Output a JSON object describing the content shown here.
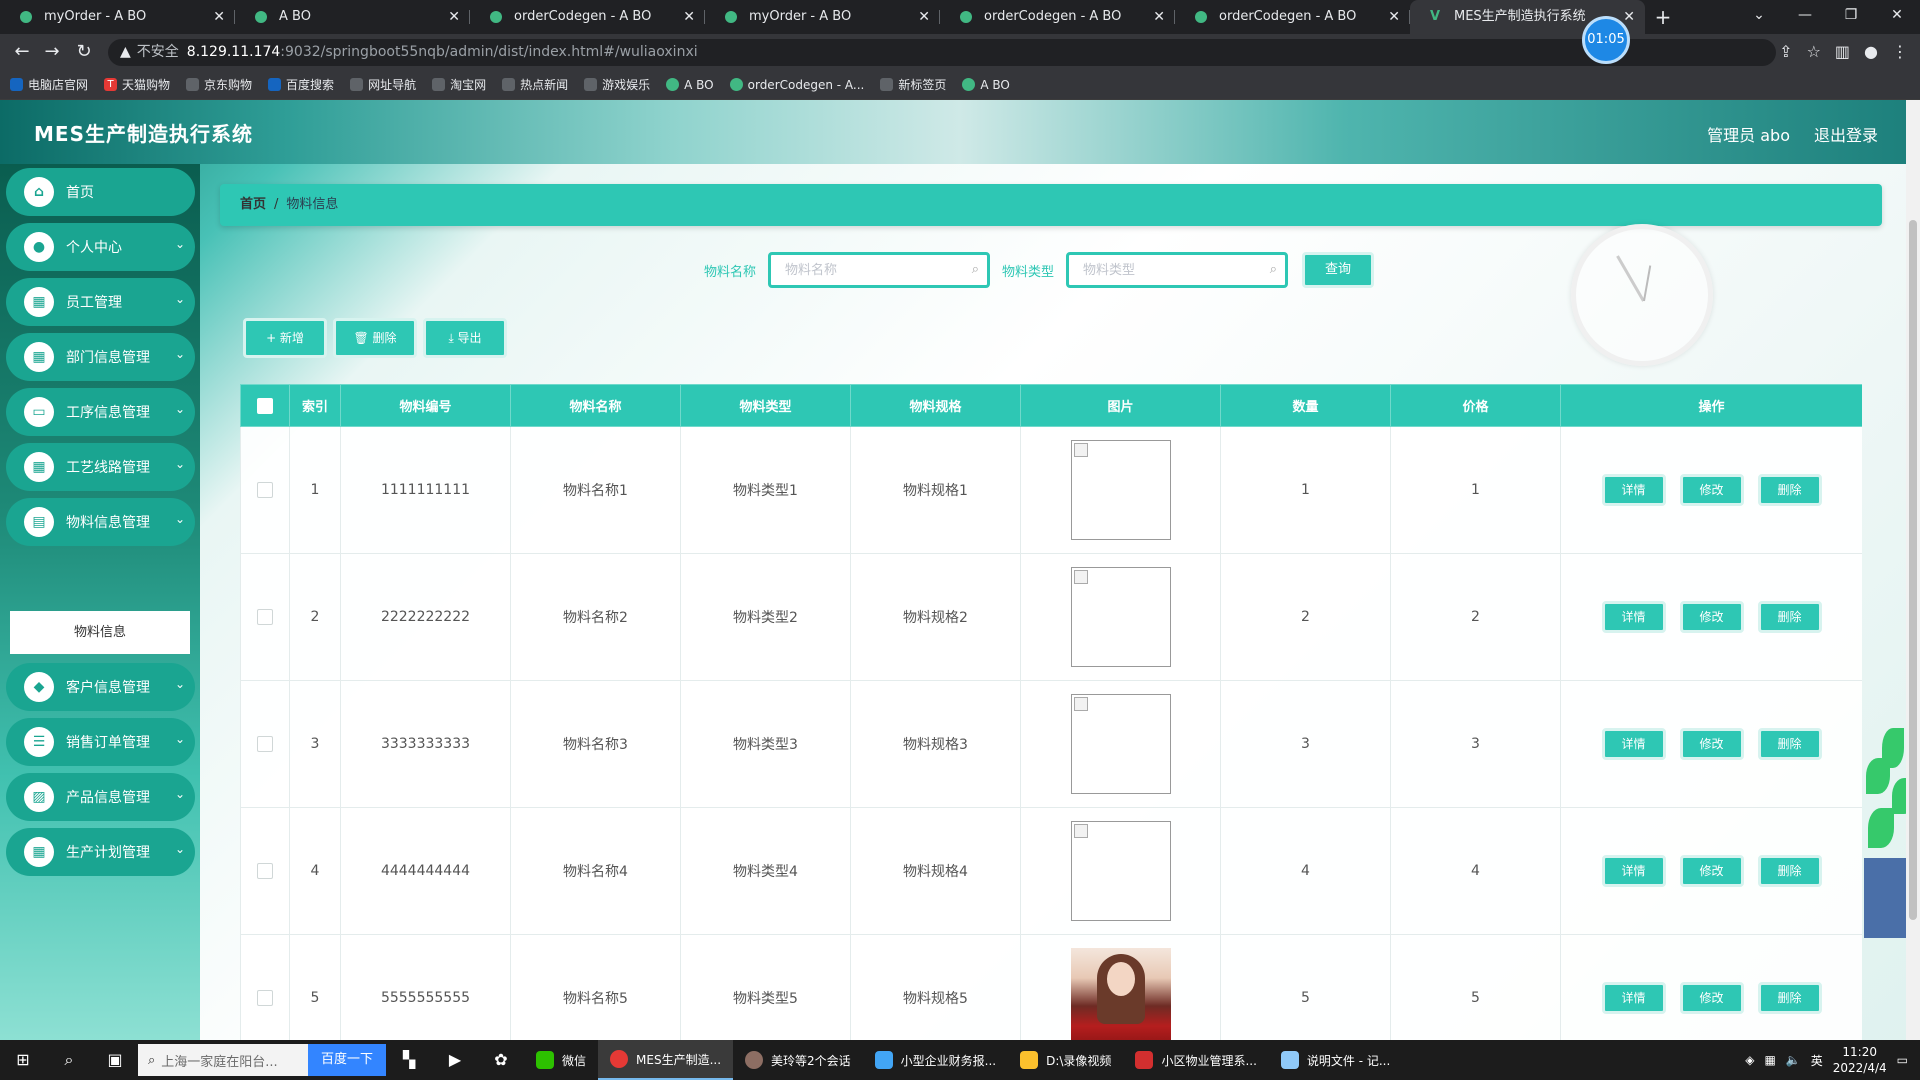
{
  "browser": {
    "tabs": [
      {
        "title": "myOrder - A BO"
      },
      {
        "title": "A BO"
      },
      {
        "title": "orderCodegen - A BO"
      },
      {
        "title": "myOrder - A BO"
      },
      {
        "title": "orderCodegen - A BO"
      },
      {
        "title": "orderCodegen - A BO"
      },
      {
        "title": "MES生产制造执行系统"
      }
    ],
    "timer_badge": "01:05",
    "address": {
      "security_label": "不安全",
      "host": "8.129.11.174",
      "path": ":9032/springboot55nqb/admin/dist/index.html#/wuliaoxinxi"
    },
    "bookmarks": [
      "电脑店官网",
      "天猫购物",
      "京东购物",
      "百度搜索",
      "网址导航",
      "淘宝网",
      "热点新闻",
      "游戏娱乐",
      "A BO",
      "orderCodegen - A...",
      "新标签页",
      "A BO"
    ]
  },
  "app": {
    "title": "MES生产制造执行系统",
    "user_label": "管理员 abo",
    "logout_label": "退出登录"
  },
  "sidebar": {
    "items": [
      {
        "label": "首页",
        "icon": "home-icon"
      },
      {
        "label": "个人中心",
        "icon": "user-icon"
      },
      {
        "label": "员工管理",
        "icon": "grid-icon"
      },
      {
        "label": "部门信息管理",
        "icon": "grid-icon"
      },
      {
        "label": "工序信息管理",
        "icon": "monitor-icon"
      },
      {
        "label": "工艺线路管理",
        "icon": "grid-icon"
      },
      {
        "label": "物料信息管理",
        "icon": "clipboard-icon"
      },
      {
        "label": "客户信息管理",
        "icon": "badge-icon"
      },
      {
        "label": "销售订单管理",
        "icon": "list-icon"
      },
      {
        "label": "产品信息管理",
        "icon": "chart-icon"
      },
      {
        "label": "生产计划管理",
        "icon": "grid-icon"
      }
    ],
    "submenu_active": "物料信息"
  },
  "breadcrumb": {
    "home": "首页",
    "sep": "/",
    "current": "物料信息"
  },
  "search": {
    "name_label": "物料名称",
    "name_placeholder": "物料名称",
    "type_label": "物料类型",
    "type_placeholder": "物料类型",
    "query_label": "查询"
  },
  "actions": {
    "add": "+ 新增",
    "delete": "🗑 删除",
    "export": "⤓ 导出"
  },
  "table": {
    "headers": [
      "索引",
      "物料编号",
      "物料名称",
      "物料类型",
      "物料规格",
      "图片",
      "数量",
      "价格",
      "操作"
    ],
    "rows": [
      {
        "index": "1",
        "code": "1111111111",
        "name": "物料名称1",
        "type": "物料类型1",
        "spec": "物料规格1",
        "qty": "1",
        "price": "1"
      },
      {
        "index": "2",
        "code": "2222222222",
        "name": "物料名称2",
        "type": "物料类型2",
        "spec": "物料规格2",
        "qty": "2",
        "price": "2"
      },
      {
        "index": "3",
        "code": "3333333333",
        "name": "物料名称3",
        "type": "物料类型3",
        "spec": "物料规格3",
        "qty": "3",
        "price": "3"
      },
      {
        "index": "4",
        "code": "4444444444",
        "name": "物料名称4",
        "type": "物料类型4",
        "spec": "物料规格4",
        "qty": "4",
        "price": "4"
      },
      {
        "index": "5",
        "code": "5555555555",
        "name": "物料名称5",
        "type": "物料类型5",
        "spec": "物料规格5",
        "qty": "5",
        "price": "5"
      }
    ],
    "row_actions": {
      "detail": "详情",
      "edit": "修改",
      "delete": "删除"
    }
  },
  "taskbar": {
    "search_placeholder": "上海一家庭在阳台...",
    "search_button": "百度一下",
    "apps": [
      "微信",
      "MES生产制造...",
      "美玲等2个会话",
      "小型企业财务报...",
      "D:\\录像视频",
      "小区物业管理系...",
      "说明文件 - 记..."
    ],
    "ime": "英",
    "time": "11:20",
    "date": "2022/4/4"
  }
}
